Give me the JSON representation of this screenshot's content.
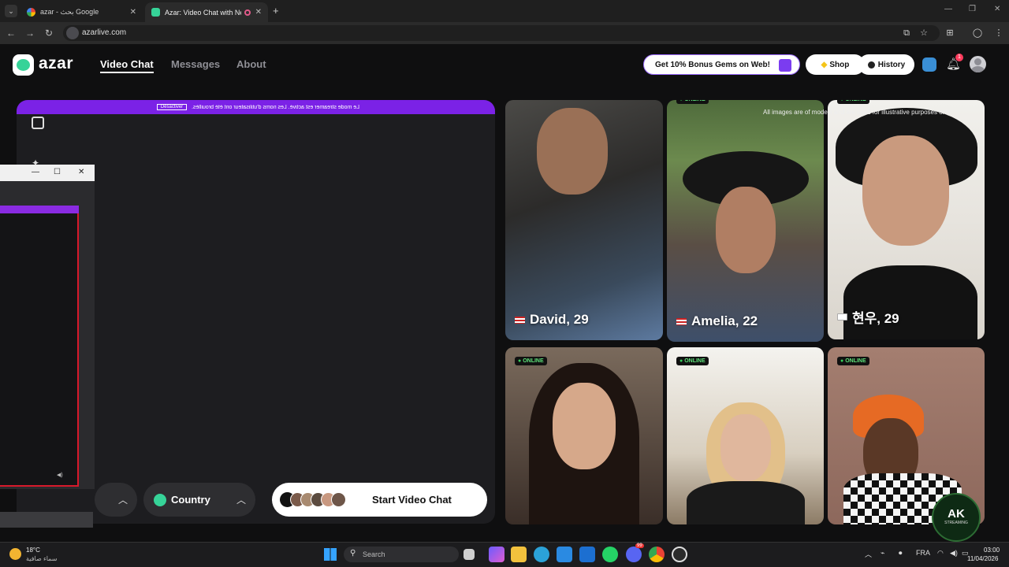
{
  "browser": {
    "tabs": [
      {
        "label": "azar - بحث Google",
        "close": "✕"
      },
      {
        "label": "Azar: Video Chat with New",
        "close": "✕"
      }
    ],
    "new_tab": "+",
    "url": "azarlive.com"
  },
  "site": {
    "logo_text": "azar",
    "nav": {
      "video_chat": "Video Chat",
      "messages": "Messages",
      "about": "About"
    },
    "promo": "Get 10% Bonus Gems on Web!",
    "shop": "Shop",
    "history": "History",
    "notification_count": "1",
    "accent_color": "#7b22e6"
  },
  "video_panel": {
    "banner_text_left": "Le mode streamer est activé. Les noms d'utilisateur ont été brouillés.",
    "banner_button": "Désactiver",
    "country_label": "Country",
    "start_label": "Start Video Chat"
  },
  "grid": {
    "disclaimer": "All images are of models and are used for illustrative purposes only",
    "online_label": "ONLINE",
    "cards": [
      {
        "name": "David, 29",
        "flag": "us"
      },
      {
        "name": "Amelia, 22",
        "flag": "us"
      },
      {
        "name": "현우, 29",
        "flag": "kr"
      },
      {
        "name": "",
        "flag": ""
      },
      {
        "name": "",
        "flag": ""
      },
      {
        "name": "",
        "flag": ""
      }
    ]
  },
  "floating_window": {
    "minimize": "—",
    "maximize": "☐",
    "close": "✕"
  },
  "watermark": {
    "line1": "AK",
    "line2": "STREAMING"
  },
  "taskbar": {
    "weather_temp": "18°C",
    "weather_desc": "سماء صافية",
    "search_placeholder": "Search",
    "lang": "FRA",
    "time": "03:00",
    "date": "11/04/2026",
    "discord_badge": "99"
  }
}
